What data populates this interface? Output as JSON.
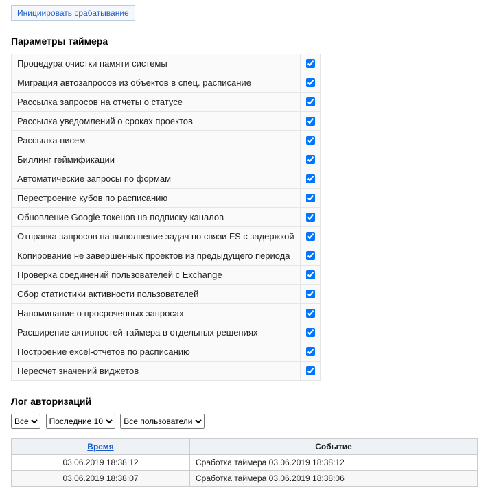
{
  "init_button": "Инициировать срабатывание",
  "params_heading": "Параметры таймера",
  "params": [
    {
      "label": "Процедура очистки памяти системы",
      "checked": true
    },
    {
      "label": "Миграция автозапросов из объектов в спец. расписание",
      "checked": true
    },
    {
      "label": "Рассылка запросов на отчеты о статусе",
      "checked": true
    },
    {
      "label": "Рассылка уведомлений о сроках проектов",
      "checked": true
    },
    {
      "label": "Рассылка писем",
      "checked": true
    },
    {
      "label": "Биллинг геймификации",
      "checked": true
    },
    {
      "label": "Автоматические запросы по формам",
      "checked": true
    },
    {
      "label": "Перестроение кубов по расписанию",
      "checked": true
    },
    {
      "label": "Обновление Google токенов на подписку каналов",
      "checked": true
    },
    {
      "label": "Отправка запросов на выполнение задач по связи FS с задержкой",
      "checked": true
    },
    {
      "label": "Копирование не завершенных проектов из предыдущего периода",
      "checked": true
    },
    {
      "label": "Проверка соединений пользователей с Exchange",
      "checked": true
    },
    {
      "label": "Сбор статистики активности пользователей",
      "checked": true
    },
    {
      "label": "Напоминание о просроченных запросах",
      "checked": true
    },
    {
      "label": "Расширение активностей таймера в отдельных решениях",
      "checked": true
    },
    {
      "label": "Построение excel-отчетов по расписанию",
      "checked": true
    },
    {
      "label": "Пересчет значений виджетов",
      "checked": true
    }
  ],
  "log_heading": "Лог авторизаций",
  "filters": {
    "f1": "Все",
    "f2": "Последние 10",
    "f3": "Все пользователи"
  },
  "log": {
    "col_time": "Время",
    "col_event": "Событие",
    "rows": [
      {
        "time": "03.06.2019 18:38:12",
        "event": "Сработка таймера 03.06.2019 18:38:12"
      },
      {
        "time": "03.06.2019 18:38:07",
        "event": "Сработка таймера 03.06.2019 18:38:06"
      }
    ]
  }
}
